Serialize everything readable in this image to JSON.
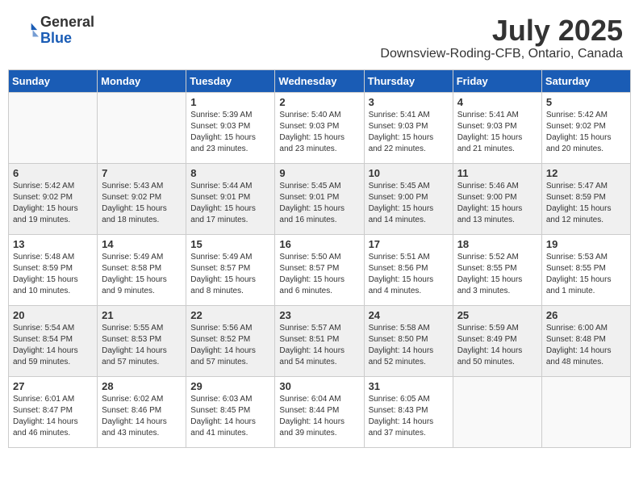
{
  "header": {
    "logo_line1": "General",
    "logo_line2": "Blue",
    "month": "July 2025",
    "location": "Downsview-Roding-CFB, Ontario, Canada"
  },
  "weekdays": [
    "Sunday",
    "Monday",
    "Tuesday",
    "Wednesday",
    "Thursday",
    "Friday",
    "Saturday"
  ],
  "weeks": [
    [
      {
        "day": "",
        "info": ""
      },
      {
        "day": "",
        "info": ""
      },
      {
        "day": "1",
        "info": "Sunrise: 5:39 AM\nSunset: 9:03 PM\nDaylight: 15 hours\nand 23 minutes."
      },
      {
        "day": "2",
        "info": "Sunrise: 5:40 AM\nSunset: 9:03 PM\nDaylight: 15 hours\nand 23 minutes."
      },
      {
        "day": "3",
        "info": "Sunrise: 5:41 AM\nSunset: 9:03 PM\nDaylight: 15 hours\nand 22 minutes."
      },
      {
        "day": "4",
        "info": "Sunrise: 5:41 AM\nSunset: 9:03 PM\nDaylight: 15 hours\nand 21 minutes."
      },
      {
        "day": "5",
        "info": "Sunrise: 5:42 AM\nSunset: 9:02 PM\nDaylight: 15 hours\nand 20 minutes."
      }
    ],
    [
      {
        "day": "6",
        "info": "Sunrise: 5:42 AM\nSunset: 9:02 PM\nDaylight: 15 hours\nand 19 minutes."
      },
      {
        "day": "7",
        "info": "Sunrise: 5:43 AM\nSunset: 9:02 PM\nDaylight: 15 hours\nand 18 minutes."
      },
      {
        "day": "8",
        "info": "Sunrise: 5:44 AM\nSunset: 9:01 PM\nDaylight: 15 hours\nand 17 minutes."
      },
      {
        "day": "9",
        "info": "Sunrise: 5:45 AM\nSunset: 9:01 PM\nDaylight: 15 hours\nand 16 minutes."
      },
      {
        "day": "10",
        "info": "Sunrise: 5:45 AM\nSunset: 9:00 PM\nDaylight: 15 hours\nand 14 minutes."
      },
      {
        "day": "11",
        "info": "Sunrise: 5:46 AM\nSunset: 9:00 PM\nDaylight: 15 hours\nand 13 minutes."
      },
      {
        "day": "12",
        "info": "Sunrise: 5:47 AM\nSunset: 8:59 PM\nDaylight: 15 hours\nand 12 minutes."
      }
    ],
    [
      {
        "day": "13",
        "info": "Sunrise: 5:48 AM\nSunset: 8:59 PM\nDaylight: 15 hours\nand 10 minutes."
      },
      {
        "day": "14",
        "info": "Sunrise: 5:49 AM\nSunset: 8:58 PM\nDaylight: 15 hours\nand 9 minutes."
      },
      {
        "day": "15",
        "info": "Sunrise: 5:49 AM\nSunset: 8:57 PM\nDaylight: 15 hours\nand 8 minutes."
      },
      {
        "day": "16",
        "info": "Sunrise: 5:50 AM\nSunset: 8:57 PM\nDaylight: 15 hours\nand 6 minutes."
      },
      {
        "day": "17",
        "info": "Sunrise: 5:51 AM\nSunset: 8:56 PM\nDaylight: 15 hours\nand 4 minutes."
      },
      {
        "day": "18",
        "info": "Sunrise: 5:52 AM\nSunset: 8:55 PM\nDaylight: 15 hours\nand 3 minutes."
      },
      {
        "day": "19",
        "info": "Sunrise: 5:53 AM\nSunset: 8:55 PM\nDaylight: 15 hours\nand 1 minute."
      }
    ],
    [
      {
        "day": "20",
        "info": "Sunrise: 5:54 AM\nSunset: 8:54 PM\nDaylight: 14 hours\nand 59 minutes."
      },
      {
        "day": "21",
        "info": "Sunrise: 5:55 AM\nSunset: 8:53 PM\nDaylight: 14 hours\nand 57 minutes."
      },
      {
        "day": "22",
        "info": "Sunrise: 5:56 AM\nSunset: 8:52 PM\nDaylight: 14 hours\nand 57 minutes."
      },
      {
        "day": "23",
        "info": "Sunrise: 5:57 AM\nSunset: 8:51 PM\nDaylight: 14 hours\nand 54 minutes."
      },
      {
        "day": "24",
        "info": "Sunrise: 5:58 AM\nSunset: 8:50 PM\nDaylight: 14 hours\nand 52 minutes."
      },
      {
        "day": "25",
        "info": "Sunrise: 5:59 AM\nSunset: 8:49 PM\nDaylight: 14 hours\nand 50 minutes."
      },
      {
        "day": "26",
        "info": "Sunrise: 6:00 AM\nSunset: 8:48 PM\nDaylight: 14 hours\nand 48 minutes."
      }
    ],
    [
      {
        "day": "27",
        "info": "Sunrise: 6:01 AM\nSunset: 8:47 PM\nDaylight: 14 hours\nand 46 minutes."
      },
      {
        "day": "28",
        "info": "Sunrise: 6:02 AM\nSunset: 8:46 PM\nDaylight: 14 hours\nand 43 minutes."
      },
      {
        "day": "29",
        "info": "Sunrise: 6:03 AM\nSunset: 8:45 PM\nDaylight: 14 hours\nand 41 minutes."
      },
      {
        "day": "30",
        "info": "Sunrise: 6:04 AM\nSunset: 8:44 PM\nDaylight: 14 hours\nand 39 minutes."
      },
      {
        "day": "31",
        "info": "Sunrise: 6:05 AM\nSunset: 8:43 PM\nDaylight: 14 hours\nand 37 minutes."
      },
      {
        "day": "",
        "info": ""
      },
      {
        "day": "",
        "info": ""
      }
    ]
  ]
}
